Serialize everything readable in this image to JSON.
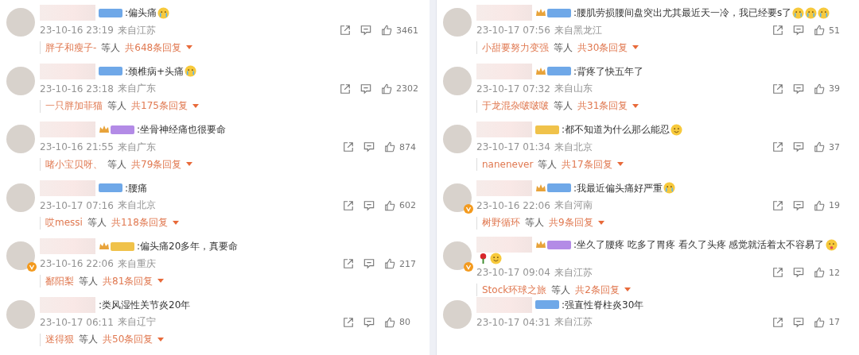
{
  "columns": [
    {
      "comments": [
        {
          "badge": {
            "color": "#6fa8e8",
            "crown": false
          },
          "verified": false,
          "text": ":偏头痛",
          "emojis": [
            {
              "kind": "cry"
            }
          ],
          "time": "23-10-16 23:19",
          "location": "来自江苏",
          "likes": "3461",
          "reply_user": "胖子和瘦子-",
          "reply_others": "等人",
          "reply_count": "共648条回复"
        },
        {
          "badge": {
            "color": "#6fa8e8",
            "crown": false
          },
          "verified": false,
          "text": ":颈椎病+头痛",
          "emojis": [
            {
              "kind": "cry"
            }
          ],
          "time": "23-10-16 23:18",
          "location": "来自广东",
          "likes": "2302",
          "reply_user": "一只胖加菲猫",
          "reply_others": "等人",
          "reply_count": "共175条回复"
        },
        {
          "badge": {
            "color": "#b38be6",
            "crown": true
          },
          "verified": false,
          "text": ":坐骨神经痛也很要命",
          "time": "23-10-16 21:55",
          "location": "来自广东",
          "likes": "874",
          "reply_user": "啫小宝贝呀、",
          "reply_others": "等人",
          "reply_count": "共79条回复"
        },
        {
          "badge": {
            "color": "#6fa8e8",
            "crown": false
          },
          "verified": false,
          "text": ":腰痛",
          "time": "23-10-17 07:16",
          "location": "来自北京",
          "likes": "602",
          "reply_user": "哎messi",
          "reply_others": "等人",
          "reply_count": "共118条回复"
        },
        {
          "badge": {
            "color": "#f0c24a",
            "crown": true
          },
          "verified": true,
          "text": ":偏头痛20多年，真要命",
          "time": "23-10-16 22:06",
          "location": "来自重庆",
          "likes": "217",
          "reply_user": "鄱阳梨",
          "reply_others": "等人",
          "reply_count": "共81条回复"
        },
        {
          "verified": false,
          "text": ":类风湿性关节炎20年",
          "time": "23-10-17 06:11",
          "location": "来自辽宁",
          "likes": "80",
          "reply_user": "迷得狠",
          "reply_others": "等人",
          "reply_count": "共50条回复"
        }
      ]
    },
    {
      "comments": [
        {
          "badge": {
            "color": "#6fa8e8",
            "crown": true
          },
          "verified": false,
          "text": ":腰肌劳损腰间盘突出尤其最近天一冷，我已经要s了",
          "emojis": [
            {
              "kind": "cry"
            },
            {
              "kind": "cry"
            },
            {
              "kind": "cry"
            }
          ],
          "time": "23-10-17 07:56",
          "location": "来自黑龙江",
          "likes": "51",
          "reply_user": "小甜要努力变强",
          "reply_others": "等人",
          "reply_count": "共30条回复"
        },
        {
          "badge": {
            "color": "#6fa8e8",
            "crown": true
          },
          "verified": false,
          "text": ":背疼了快五年了",
          "time": "23-10-17 07:32",
          "location": "来自山东",
          "likes": "39",
          "reply_user": "于龙混杂啵啵啵",
          "reply_others": "等人",
          "reply_count": "共31条回复"
        },
        {
          "badge": {
            "color": "#f0c24a",
            "crown": false
          },
          "verified": false,
          "text": ":都不知道为什么那么能忍",
          "emojis": [
            {
              "kind": "laugh"
            }
          ],
          "time": "23-10-17 01:34",
          "location": "来自北京",
          "likes": "37",
          "reply_user": "nanenever",
          "reply_others": "等人",
          "reply_count": "共17条回复"
        },
        {
          "badge": {
            "color": "#6fa8e8",
            "crown": true
          },
          "verified": true,
          "text": ":我最近偏头痛好严重",
          "emojis": [
            {
              "kind": "cry"
            }
          ],
          "time": "23-10-16 22:06",
          "location": "来自河南",
          "likes": "19",
          "reply_user": "树野循环",
          "reply_others": "等人",
          "reply_count": "共9条回复"
        },
        {
          "badge": {
            "color": "#b38be6",
            "crown": true
          },
          "verified": true,
          "text": ":坐久了腰疼 吃多了胃疼 看久了头疼 感觉就活着太不容易了",
          "emojis": [
            {
              "kind": "tongue"
            },
            {
              "kind": "rose"
            },
            {
              "kind": "smile"
            }
          ],
          "time": "23-10-17 09:04",
          "location": "来自江苏",
          "likes": "12",
          "reply_user": "Stock环球之旅",
          "reply_others": "等人",
          "reply_count": "共2条回复"
        },
        {
          "badge": {
            "color": "#6fa8e8",
            "crown": false
          },
          "verified": false,
          "text": ":强直性脊柱炎30年",
          "time": "23-10-17 04:31",
          "location": "来自江苏",
          "likes": "17"
        }
      ]
    }
  ]
}
